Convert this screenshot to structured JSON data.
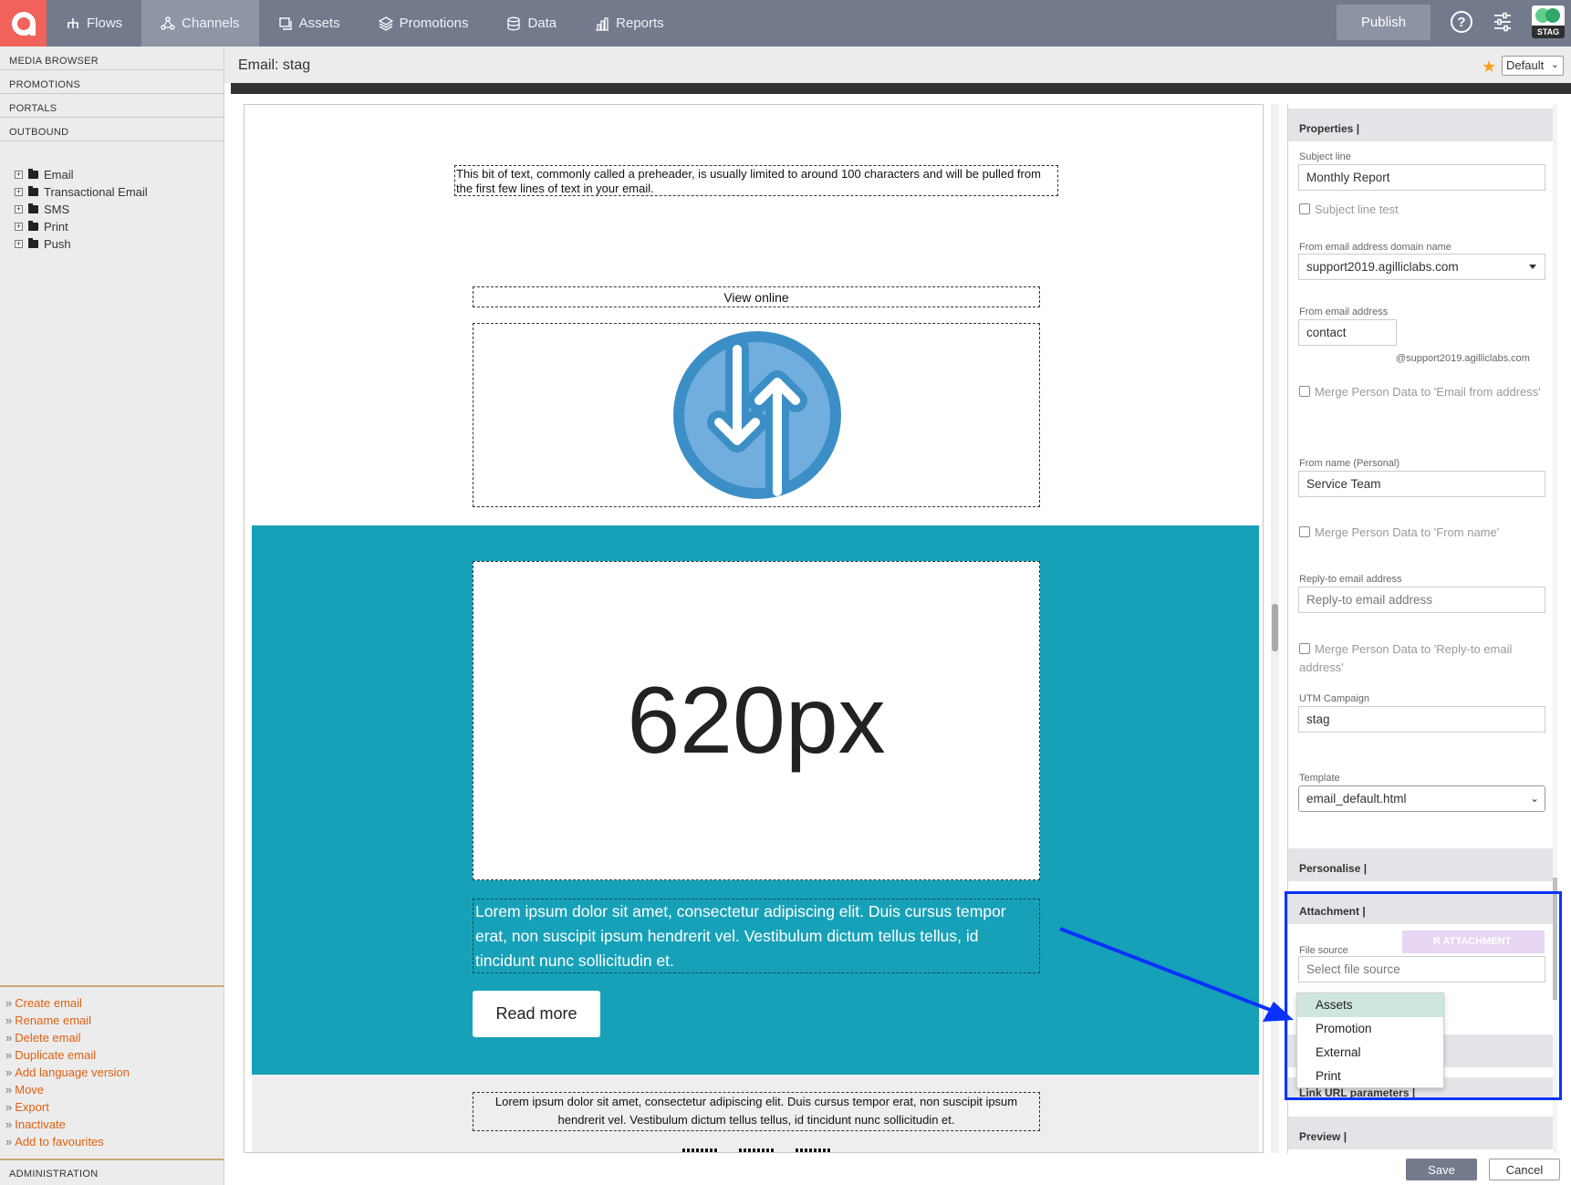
{
  "topbar": {
    "nav": [
      {
        "label": "Flows",
        "icon": "flows-icon"
      },
      {
        "label": "Channels",
        "icon": "channels-icon",
        "active": true
      },
      {
        "label": "Assets",
        "icon": "assets-icon"
      },
      {
        "label": "Promotions",
        "icon": "promotions-icon"
      },
      {
        "label": "Data",
        "icon": "data-icon"
      },
      {
        "label": "Reports",
        "icon": "reports-icon"
      }
    ],
    "publish_label": "Publish",
    "help_glyph": "?",
    "env_label": "STAG"
  },
  "sidebar": {
    "sections": [
      "MEDIA BROWSER",
      "PROMOTIONS",
      "PORTALS",
      "OUTBOUND"
    ],
    "tree": [
      "Email",
      "Transactional Email",
      "SMS",
      "Print",
      "Push"
    ],
    "actions": [
      "Create email",
      "Rename email",
      "Delete email",
      "Duplicate email",
      "Add language version",
      "Move",
      "Export",
      "Inactivate",
      "Add to favourites"
    ],
    "admin": "ADMINISTRATION"
  },
  "header": {
    "title": "Email: stag",
    "view_select": "Default"
  },
  "email": {
    "preheader": "This bit of text, commonly called a preheader, is usually limited to around 100 characters and will be pulled from the first few lines of text in your email.",
    "view_online": "View online",
    "hero_text": "620px",
    "body_text": "Lorem ipsum dolor sit amet, consectetur adipiscing elit. Duis cursus tempor erat, non suscipit ipsum hendrerit vel. Vestibulum dictum tellus tellus, id tincidunt nunc sollicitudin et.",
    "read_more": "Read more",
    "footer_text": "Lorem ipsum dolor sit amet, consectetur adipiscing elit. Duis cursus tempor erat, non suscipit ipsum hendrerit vel. Vestibulum dictum tellus tellus, id tincidunt nunc sollicitudin et.",
    "colors": {
      "teal": "#17a1b8",
      "logo_blue": "#3c8fc6",
      "logo_light": "#72aedd"
    }
  },
  "properties": {
    "heading": "Properties |",
    "subject_label": "Subject line",
    "subject_value": "Monthly Report",
    "subject_test": "Subject line test",
    "domain_label": "From email address domain name",
    "domain_value": "support2019.agilliclabs.com",
    "from_address_label": "From email address",
    "from_address_value": "contact",
    "from_address_suffix": "@support2019.agilliclabs.com",
    "merge_from_address": "Merge Person Data to 'Email from address'",
    "from_name_label": "From name (Personal)",
    "from_name_value": "Service Team",
    "merge_from_name": "Merge Person Data to 'From name'",
    "reply_label": "Reply-to email address",
    "reply_placeholder": "Reply-to email address",
    "merge_reply": "Merge Person Data to 'Reply-to email address'",
    "utm_label": "UTM Campaign",
    "utm_value": "stag",
    "template_label": "Template",
    "template_value": "email_default.html",
    "personalise_heading": "Personalise |",
    "attachment_heading": "Attachment |",
    "file_source_label": "File source",
    "file_source_placeholder": "Select file source",
    "attach_button": "R ATTACHMENT",
    "link_url_heading": "Link URL parameters |",
    "preview_heading": "Preview |"
  },
  "file_source_options": [
    "Assets",
    "Promotion",
    "External",
    "Print"
  ],
  "footer_buttons": {
    "save": "Save",
    "cancel": "Cancel"
  },
  "annotation_color": "#0a32ff"
}
